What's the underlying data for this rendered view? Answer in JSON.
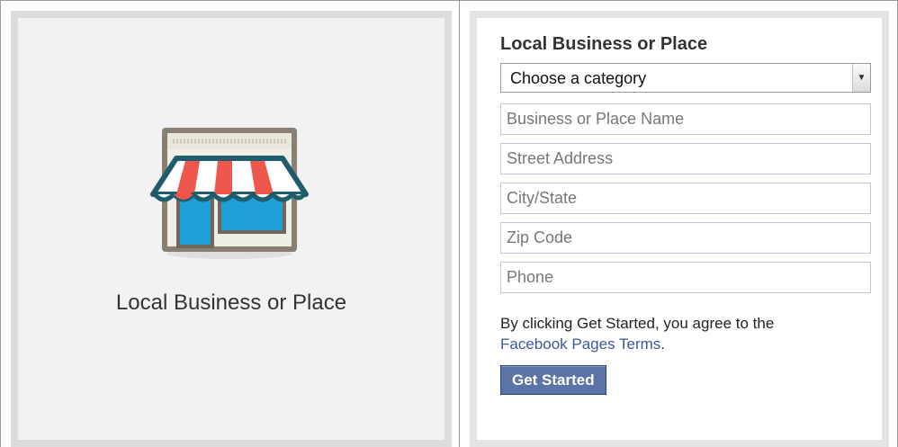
{
  "left_panel": {
    "icon": "storefront-icon",
    "caption": "Local Business or Place"
  },
  "form": {
    "title": "Local Business or Place",
    "category_select": {
      "selected": "Choose a category"
    },
    "fields": {
      "name_placeholder": "Business or Place Name",
      "street_placeholder": "Street Address",
      "city_placeholder": "City/State",
      "zip_placeholder": "Zip Code",
      "phone_placeholder": "Phone"
    },
    "terms_text": "By clicking Get Started, you agree to the",
    "terms_link": "Facebook Pages Terms",
    "terms_end": ".",
    "submit_label": "Get Started"
  },
  "colors": {
    "link": "#3b5998",
    "button": "#5b74a8",
    "awning_red": "#f0574c",
    "store_blue": "#1e9fd8"
  }
}
